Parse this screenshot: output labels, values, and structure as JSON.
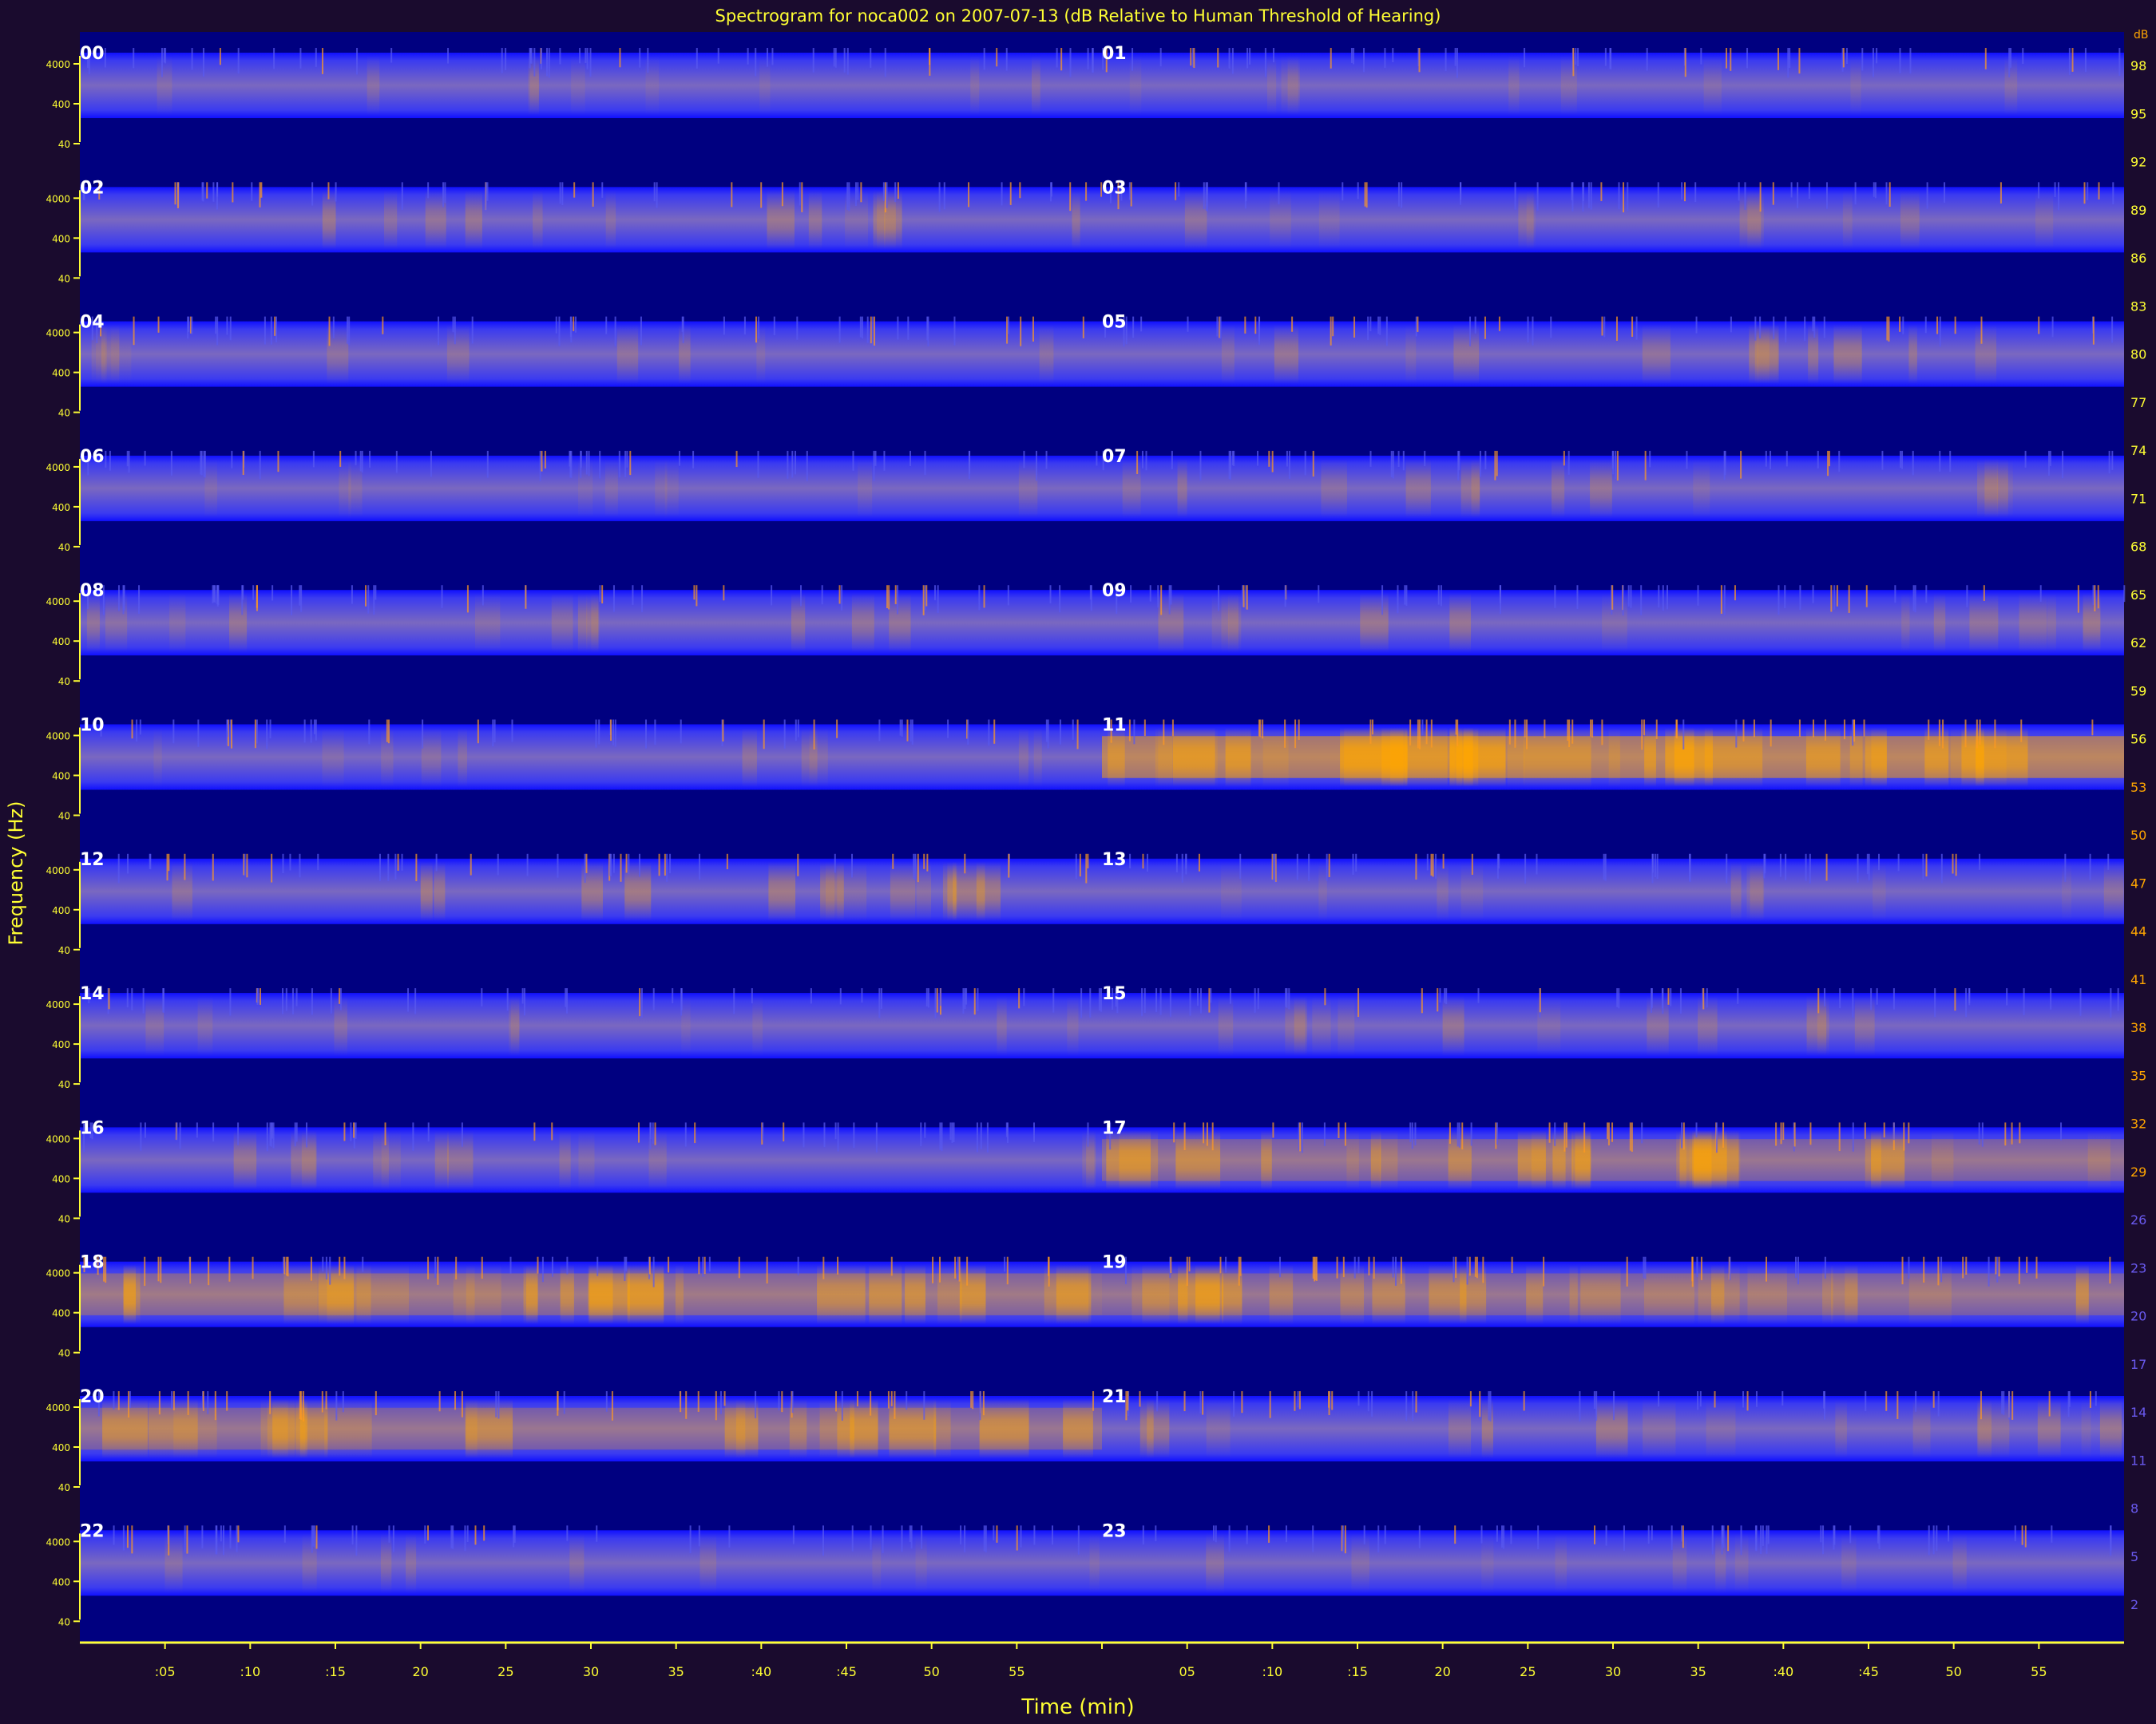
{
  "chart_data": {
    "type": "heatmap",
    "title": "Spectrogram for noca002 on 2007-07-13 (dB Relative to Human Threshold of Hearing)",
    "xlabel": "Time (min)",
    "ylabel": "Frequency (Hz)",
    "panel_hours": [
      "00",
      "01",
      "02",
      "03",
      "04",
      "05",
      "06",
      "07",
      "08",
      "09",
      "10",
      "11",
      "12",
      "13",
      "14",
      "15",
      "16",
      "17",
      "18",
      "19",
      "20",
      "21",
      "22",
      "23"
    ],
    "y_ticks": [
      "4000",
      "400",
      "40"
    ],
    "x_ticks": [
      ":05",
      ":10",
      ":15",
      "20",
      "25",
      "30",
      "35",
      ":40",
      ":45",
      "50",
      "55",
      "",
      "05",
      ":10",
      ":15",
      "20",
      "25",
      "30",
      "35",
      ":40",
      ":45",
      "50",
      "55"
    ],
    "colorbar": {
      "label": "dB",
      "ticks": [
        98,
        95,
        92,
        89,
        86,
        83,
        80,
        77,
        74,
        71,
        68,
        65,
        62,
        59,
        56,
        53,
        50,
        47,
        44,
        41,
        38,
        35,
        32,
        29,
        26,
        23,
        20,
        17,
        14,
        11,
        8,
        5,
        2
      ]
    },
    "row_intensity": [
      [
        0.15,
        0.15
      ],
      [
        0.3,
        0.2
      ],
      [
        0.2,
        0.3
      ],
      [
        0.15,
        0.25
      ],
      [
        0.25,
        0.3
      ],
      [
        0.2,
        0.85
      ],
      [
        0.35,
        0.2
      ],
      [
        0.15,
        0.25
      ],
      [
        0.25,
        0.6
      ],
      [
        0.65,
        0.6
      ],
      [
        0.6,
        0.35
      ],
      [
        0.15,
        0.15
      ]
    ]
  },
  "colors": {
    "background": "#1a0b2e",
    "plot_background": "#000080",
    "band_low": "#0000ff",
    "band_mid": "#6a5acd",
    "band_high": "#ffa500",
    "axis": "#ffff33",
    "label_white": "#ffffff"
  }
}
